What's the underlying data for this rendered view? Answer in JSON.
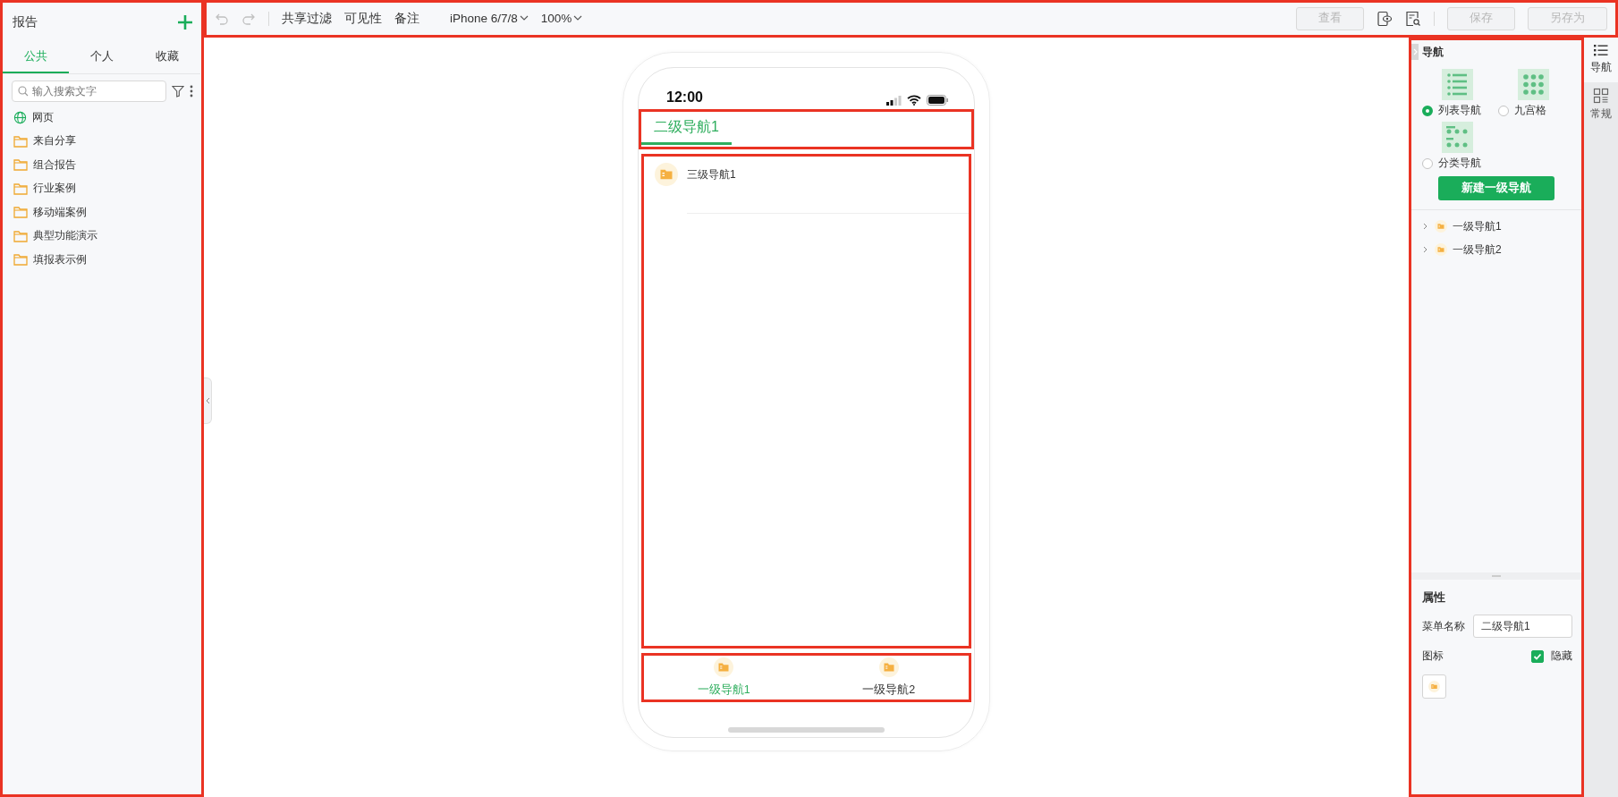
{
  "sidebar": {
    "title": "报告",
    "tabs": [
      {
        "label": "公共",
        "selected": true
      },
      {
        "label": "个人",
        "selected": false
      },
      {
        "label": "收藏",
        "selected": false
      }
    ],
    "search": {
      "placeholder": "输入搜索文字"
    },
    "items": [
      {
        "kind": "web",
        "label": "网页"
      },
      {
        "kind": "folder",
        "label": "来自分享"
      },
      {
        "kind": "folder",
        "label": "组合报告"
      },
      {
        "kind": "folder",
        "label": "行业案例"
      },
      {
        "kind": "folder",
        "label": "移动端案例"
      },
      {
        "kind": "folder",
        "label": "典型功能演示"
      },
      {
        "kind": "folder",
        "label": "填报表示例"
      }
    ]
  },
  "toolbar": {
    "history": [
      {
        "kind": "undo",
        "disabled": true
      },
      {
        "kind": "redo",
        "disabled": true
      }
    ],
    "menus": [
      "共享过滤",
      "可见性",
      "备注"
    ],
    "dropdowns": [
      "iPhone 6/7/8",
      "100%"
    ],
    "view_button": {
      "label": "查看",
      "disabled": true
    },
    "save_buttons": [
      {
        "label": "保存",
        "disabled": true
      },
      {
        "label": "另存为",
        "disabled": true
      }
    ]
  },
  "phone": {
    "time": "12:00",
    "tabs": [
      {
        "label": "二级导航1",
        "selected": true
      }
    ],
    "items": [
      {
        "label": "三级导航1"
      }
    ],
    "bottom_nav": [
      {
        "label": "一级导航1",
        "selected": true
      },
      {
        "label": "一级导航2",
        "selected": false
      }
    ]
  },
  "nav_panel": {
    "title": "导航",
    "layouts": [
      {
        "kind": "list",
        "label": "列表导航",
        "selected": true
      },
      {
        "kind": "grid",
        "label": "九宫格",
        "selected": false
      },
      {
        "kind": "category",
        "label": "分类导航",
        "selected": false
      }
    ],
    "new_button": "新建一级导航",
    "tree": [
      {
        "label": "一级导航1",
        "expanded": false
      },
      {
        "label": "一级导航2",
        "expanded": false
      }
    ]
  },
  "properties": {
    "title": "属性",
    "name_label": "菜单名称",
    "name_value": "二级导航1",
    "icon_label": "图标",
    "hide": {
      "label": "隐藏",
      "checked": true
    }
  },
  "side_tabs": [
    {
      "kind": "list",
      "label": "导航",
      "selected": true
    },
    {
      "kind": "grid",
      "label": "常规",
      "selected": false
    }
  ]
}
